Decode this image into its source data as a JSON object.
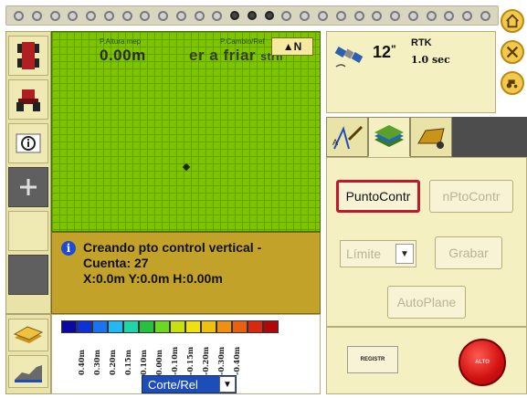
{
  "lightbar": {
    "led_count": 27,
    "center_index": 13
  },
  "map": {
    "left_label": "P.Altura mep",
    "left_value": "0.00m",
    "right_label": "P.Cambio/Ref",
    "right_value": "er a friar",
    "right_value_suffix": "strn",
    "compass_label": "▲N"
  },
  "status": {
    "line1": "Creando pto control vertical -",
    "line2": "Cuenta: 27",
    "line3": "X:0.0m Y:0.0m H:0.00m"
  },
  "gps": {
    "satellites": "12",
    "satellites_unit": "\"",
    "fix_type": "RTK",
    "age": "1.0 sec"
  },
  "tabs": [
    {
      "icon": "survey-tools-icon",
      "active": false
    },
    {
      "icon": "terrain-layers-icon",
      "active": true
    },
    {
      "icon": "scraper-icon",
      "active": false
    }
  ],
  "panel": {
    "punto_button": "PuntoContr",
    "nuevo_button": "nPtoContr",
    "limite_value": "Límite",
    "grabar_button": "Grabar",
    "autoplane_button": "AutoPlane"
  },
  "scale": {
    "colors": [
      "#0a0aa0",
      "#1030d8",
      "#1a74f0",
      "#22b8f0",
      "#20d6a8",
      "#28c040",
      "#6cd820",
      "#c8e010",
      "#f0e010",
      "#f0c010",
      "#f09010",
      "#e86010",
      "#d82810",
      "#b00808"
    ],
    "labels": [
      "0.40m",
      "0.30m",
      "0.20m",
      "0.15m",
      "0.10m",
      "0.00m",
      "-0.10m",
      "-0.15m",
      "-0.20m",
      "-0.30m",
      "-0.40m"
    ],
    "view_value": "Corte/Rel"
  },
  "actions": {
    "registro_label": "REGISTR",
    "stop_label": "ALTO"
  }
}
